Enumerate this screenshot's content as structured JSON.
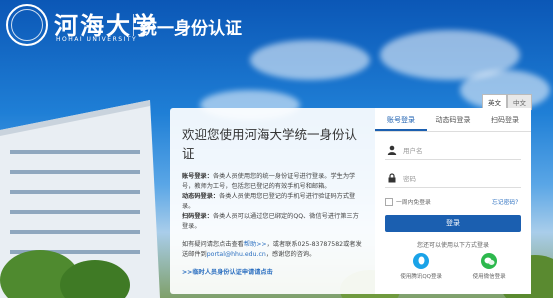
{
  "header": {
    "logo_cn": "河海大学",
    "logo_en": "HOHAI UNIVERSITY",
    "system_title": "统一身份认证"
  },
  "lang": {
    "english": "英文",
    "chinese": "中文"
  },
  "welcome": {
    "title": "欢迎您使用河海大学统一身份认证",
    "account_label": "账号登录：",
    "account_text": "各类人员使用您的统一身份证号进行登录。学生为学号，教师为工号，包括您已登记的有效手机号和邮箱。",
    "dynamic_label": "动态码登录：",
    "dynamic_text": "各类人员使用您已登记的手机号进行验证码方式登录。",
    "scan_label": "扫码登录：",
    "scan_text": "各类人员可以通过您已绑定的QQ、微信号进行第三方登录。",
    "help_prefix": "如有疑问请您点击查看",
    "help_link": "帮助>>",
    "help_middle": "，或者联系025-83787582或者发送邮件到",
    "help_email": "portal@hhu.edu.cn",
    "help_suffix": "，感谢您的咨询。",
    "temp_link": ">>临时人员身份认证申请请点击"
  },
  "login": {
    "tabs": [
      "账号登录",
      "动态码登录",
      "扫码登录"
    ],
    "username_placeholder": "用户名",
    "password_placeholder": "密码",
    "remember": "一周内免登录",
    "forgot": "忘记密码？",
    "submit": "登录",
    "alt_text": "您还可以使用以下方式登录",
    "qq": "使用腾讯QQ登录",
    "wechat": "使用微信登录"
  },
  "colors": {
    "primary": "#1b5fb0",
    "link": "#2b6fc0",
    "qq": "#1aa3e8",
    "wechat": "#2db84d"
  }
}
